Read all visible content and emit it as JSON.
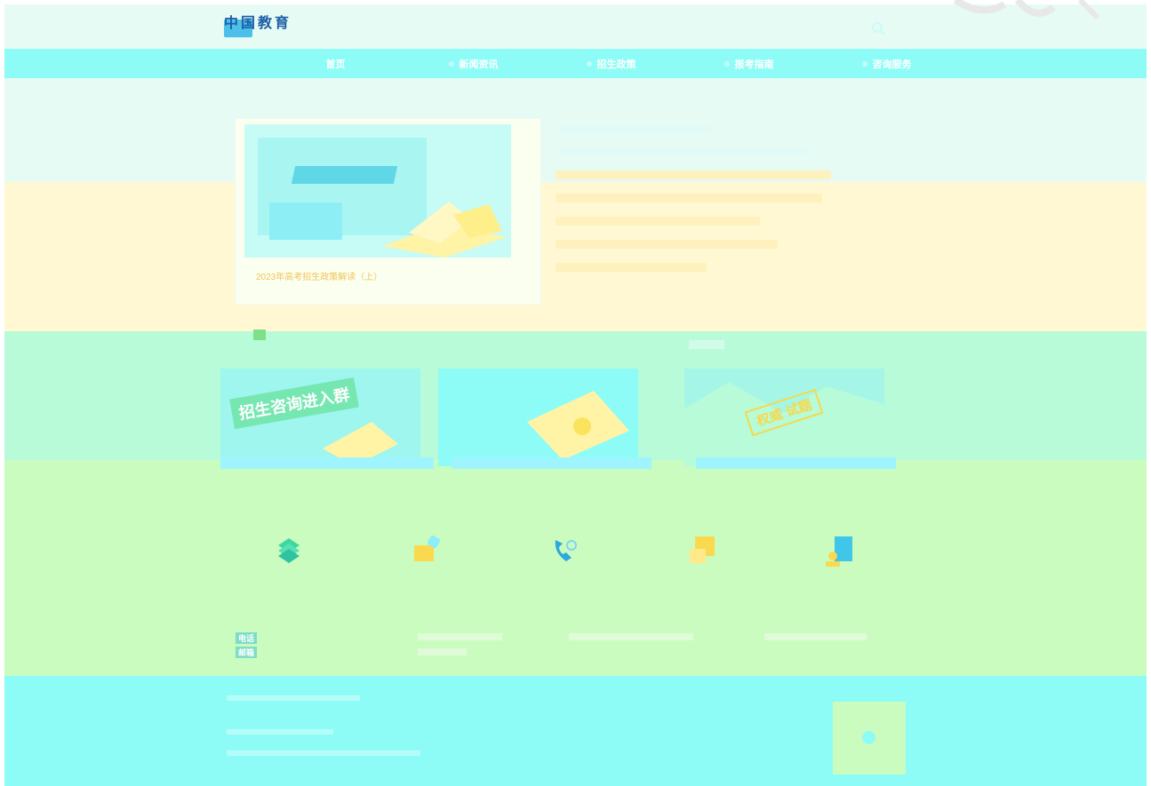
{
  "header": {
    "logo_main": "中国教育",
    "logo_sub": "",
    "search_icon": "search-icon"
  },
  "nav": {
    "items": [
      {
        "label": "首页"
      },
      {
        "label": "新闻资讯"
      },
      {
        "label": "招生政策"
      },
      {
        "label": "报考指南"
      },
      {
        "label": "咨询服务"
      }
    ]
  },
  "news": {
    "section_title": "",
    "feature_tag": "",
    "feature_caption": "2023年高考招生政策解读（上）"
  },
  "banners": [
    {
      "text": "招生咨询进入群"
    },
    {
      "text": ""
    },
    {
      "text": "权威 试题"
    }
  ],
  "services": {
    "section_title": "",
    "items": [
      {
        "icon": "book-stack-icon",
        "label": ""
      },
      {
        "icon": "mail-icon",
        "label": ""
      },
      {
        "icon": "phone-icon",
        "label": ""
      },
      {
        "icon": "folder-icon",
        "label": ""
      },
      {
        "icon": "user-card-icon",
        "label": ""
      }
    ]
  },
  "contacts": [
    {
      "key": "电话",
      "value": ""
    },
    {
      "key": "邮箱",
      "value": ""
    }
  ],
  "footer": {
    "links": [
      "",
      "",
      ""
    ],
    "line1": "",
    "line2": ""
  },
  "colors": {
    "brand": "#1e5fa8",
    "accent": "#5fd7e6",
    "nav_bg": "#8efcf6",
    "highlight": "#f2c45a"
  }
}
